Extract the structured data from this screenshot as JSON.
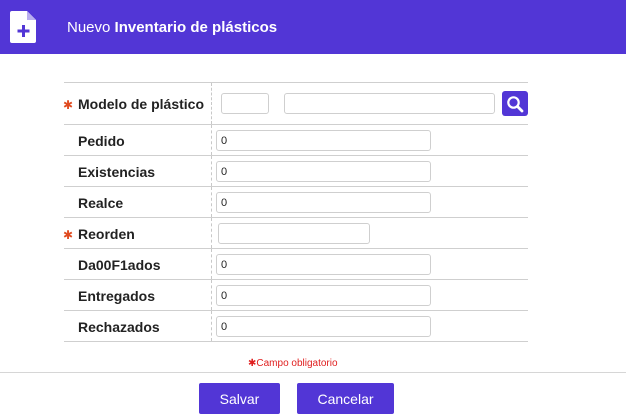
{
  "header": {
    "title_prefix": "Nuevo",
    "title_bold": "Inventario de plásticos",
    "icon": "new-document-icon"
  },
  "form": {
    "modelo": {
      "label": "Modelo de plástico",
      "required": true,
      "code_value": "",
      "description_value": "",
      "search_icon": "search-icon"
    },
    "fields": [
      {
        "label": "Pedido",
        "value": "0",
        "required": false
      },
      {
        "label": "Existencias",
        "value": "0",
        "required": false
      },
      {
        "label": "Realce",
        "value": "0",
        "required": false
      },
      {
        "label": "Reorden",
        "value": "",
        "required": true
      },
      {
        "label": "Da00F1ados",
        "value": "0",
        "required": false
      },
      {
        "label": "Entregados",
        "value": "0",
        "required": false
      },
      {
        "label": "Rechazados",
        "value": "0",
        "required": false
      }
    ],
    "required_star": "✱",
    "required_note": "Campo obligatorio"
  },
  "buttons": {
    "save": "Salvar",
    "cancel": "Cancelar"
  },
  "colors": {
    "accent": "#5236d6",
    "required": "#e04a1f"
  }
}
